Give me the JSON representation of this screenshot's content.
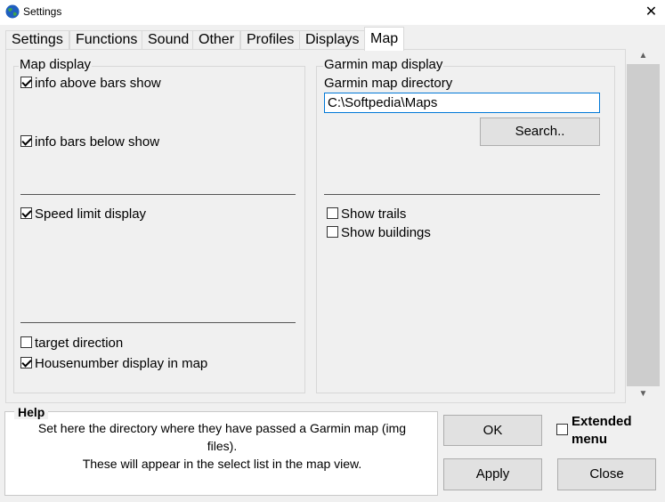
{
  "window": {
    "title": "Settings",
    "close_glyph": "✕"
  },
  "tabs": [
    {
      "label": "Settings"
    },
    {
      "label": "Functions"
    },
    {
      "label": "Sound"
    },
    {
      "label": "Other"
    },
    {
      "label": "Profiles"
    },
    {
      "label": "Displays"
    },
    {
      "label": "Map",
      "active": true
    }
  ],
  "map_display": {
    "title": "Map display",
    "info_above": {
      "label": "info above bars show",
      "checked": true
    },
    "info_below": {
      "label": "info bars below show",
      "checked": true
    },
    "speed_limit": {
      "label": "Speed limit display",
      "checked": true
    },
    "target_direction": {
      "label": "target direction",
      "checked": false
    },
    "housenumber": {
      "label": "Housenumber display in map",
      "checked": true
    }
  },
  "garmin": {
    "title": "Garmin map display",
    "dir_label": "Garmin map directory",
    "dir_value": "C:\\Softpedia\\Maps",
    "search_label": "Search..",
    "show_trails": {
      "label": "Show trails",
      "checked": false
    },
    "show_buildings": {
      "label": "Show buildings",
      "checked": false
    }
  },
  "help": {
    "title": "Help",
    "line1": "Set here the directory where they have passed a Garmin map (img",
    "line2": "files).",
    "line3": "These will appear in the select list in the map view."
  },
  "buttons": {
    "ok": "OK",
    "apply": "Apply",
    "close": "Close"
  },
  "extended_menu": {
    "line1": "Extended",
    "line2": "menu",
    "checked": false
  },
  "colors": {
    "window_bg": "#f0f0f0",
    "focus_border": "#0078d7",
    "button_bg": "#e1e1e1"
  }
}
